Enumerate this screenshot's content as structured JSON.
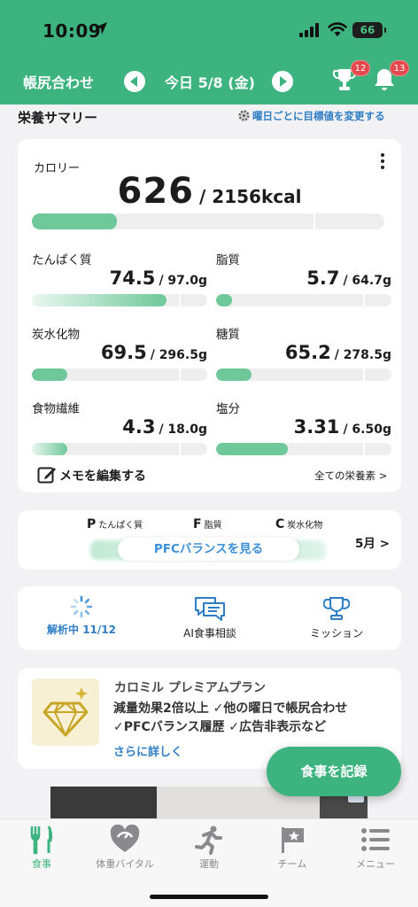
{
  "status": {
    "time": "10:09",
    "battery": "66"
  },
  "header": {
    "book_label": "帳尻合わせ",
    "date": "今日 5/8 (金)",
    "trophy_badge": "12",
    "bell_badge": "13"
  },
  "summary": {
    "title": "栄養サマリー",
    "settings_link": "曜日ごとに目標値を変更する",
    "calorie_label": "カロリー",
    "calorie_value": "626",
    "calorie_goal": "/ 2156kcal",
    "calorie_progress": 0.24,
    "nutrients": [
      {
        "label": "たんぱく質",
        "value": "74.5",
        "goal": "/ 97.0g",
        "progress": 0.77
      },
      {
        "label": "脂質",
        "value": "5.7",
        "goal": "/ 64.7g",
        "progress": 0.09
      },
      {
        "label": "炭水化物",
        "value": "69.5",
        "goal": "/ 296.5g",
        "progress": 0.2
      },
      {
        "label": "糖質",
        "value": "65.2",
        "goal": "/ 278.5g",
        "progress": 0.2
      },
      {
        "label": "食物繊維",
        "value": "4.3",
        "goal": "/ 18.0g",
        "progress": 0.2
      },
      {
        "label": "塩分",
        "value": "3.31",
        "goal": "/ 6.50g",
        "progress": 0.41
      }
    ],
    "memo_label": "メモを編集する",
    "all_nutrients_link": "全ての栄養素 >"
  },
  "pfc": {
    "p_letter": "P",
    "p_label": "たんぱく質",
    "f_letter": "F",
    "f_label": "脂質",
    "c_letter": "C",
    "c_label": "炭水化物",
    "button_label": "PFCバランスを見る",
    "month_link": "5月 >"
  },
  "actions": {
    "analyzing": "解析中 11/12",
    "ai_consult": "AI食事相談",
    "mission": "ミッション"
  },
  "premium": {
    "title": "カロミル プレミアムプラン",
    "line1": "減量効果2倍以上 ✓他の曜日で帳尻合わせ",
    "line2": "✓PFCバランス履歴 ✓広告非表示など",
    "more_link": "さらに詳しく"
  },
  "fab_label": "食事を記録",
  "tabs": [
    "食事",
    "体重バイタル",
    "運動",
    "チーム",
    "メニュー"
  ],
  "colors": {
    "brand": "#3db37f",
    "link": "#2f7ec5",
    "bar_fill": "#6fc89a"
  }
}
